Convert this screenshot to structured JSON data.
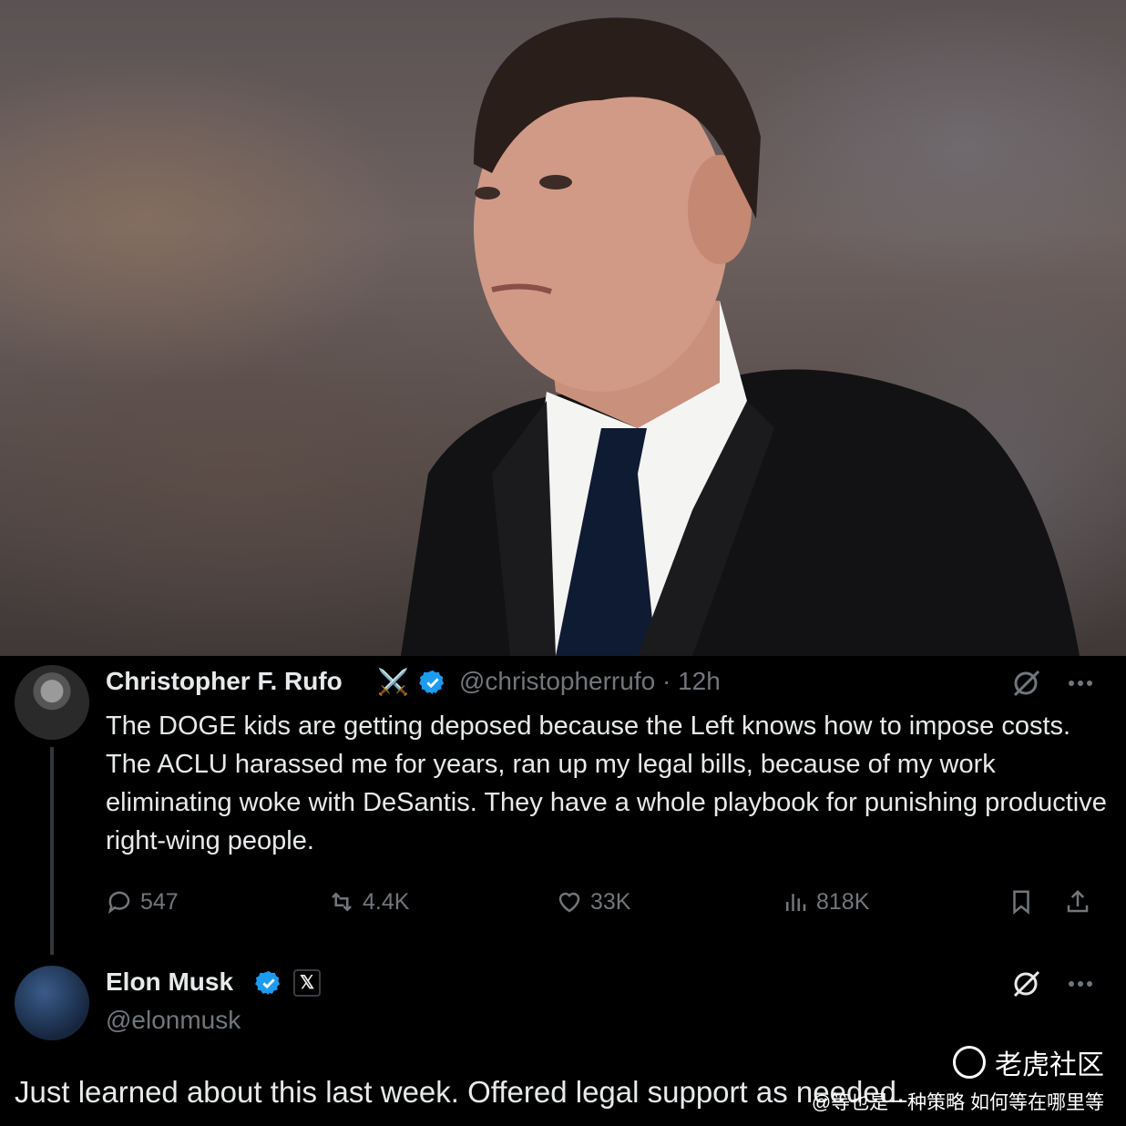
{
  "photo": {
    "alt_icon": "portrait-photo"
  },
  "tweet1": {
    "name": "Christopher F. Rufo",
    "emoji": "⚔️",
    "handle_time": "@christopherrufo · 12h",
    "body": "The DOGE kids are getting deposed because the Left knows how to impose costs. The ACLU harassed me for years, ran up my legal bills, because of my work eliminating woke with DeSantis. They have a whole playbook for punishing productive right-wing people.",
    "replies": "547",
    "reposts": "4.4K",
    "likes": "33K",
    "views": "818K"
  },
  "tweet2": {
    "name": "Elon Musk",
    "badge": "𝕏",
    "handle": "@elonmusk",
    "body": "Just learned about this last week. Offered legal support as needed."
  },
  "watermark": {
    "brand": "老虎社区",
    "author": "@等也是一种策略 如何等在哪里等"
  },
  "colors": {
    "background": "#000000",
    "text": "#e7e9ea",
    "muted": "#71767b",
    "verified": "#1d9bf0"
  }
}
